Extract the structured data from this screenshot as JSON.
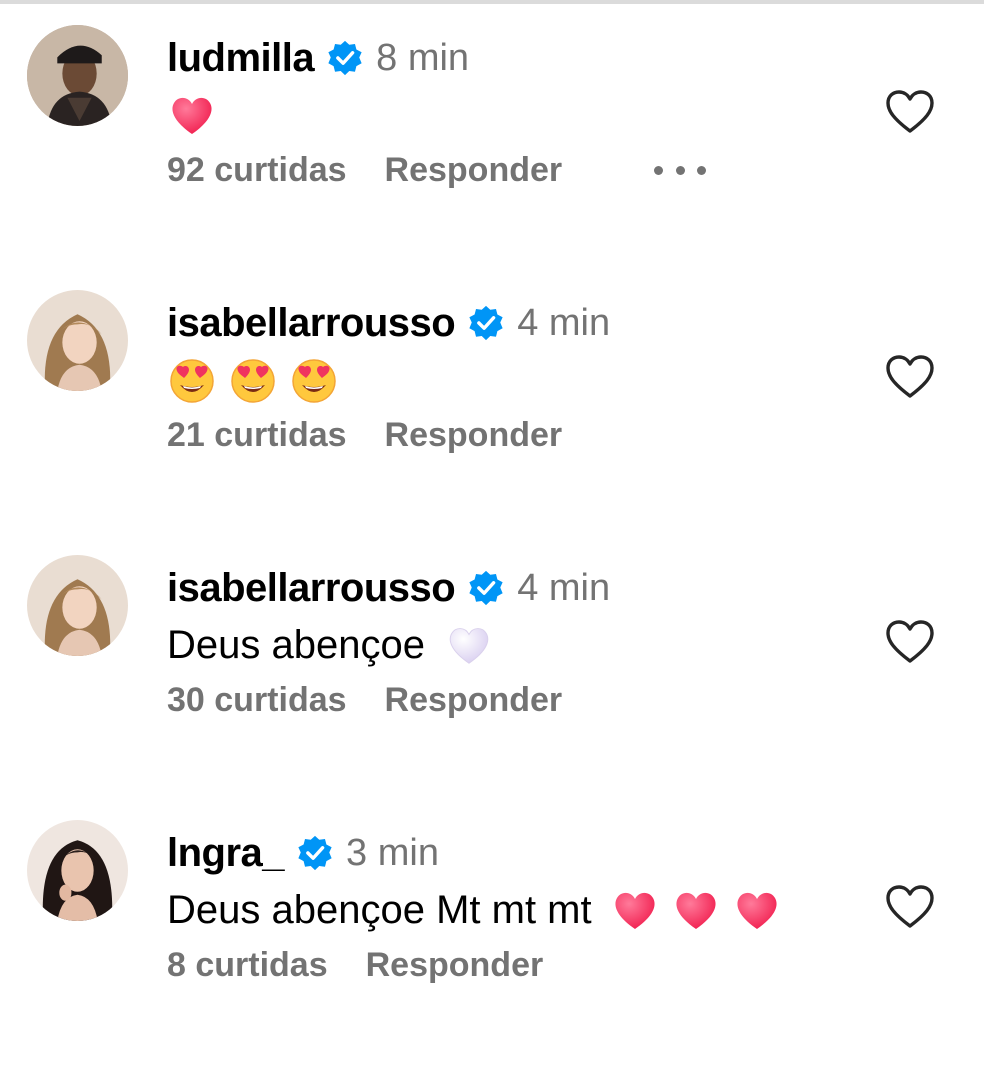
{
  "colors": {
    "text": "#000000",
    "muted": "#737373",
    "verified": "#0095f6",
    "heart_red": "#ff2e57",
    "heart_white": "#e6def7"
  },
  "comments": [
    {
      "username": "ludmilla",
      "verified": true,
      "time": "8 min",
      "text": "",
      "emojis": [
        "red-heart"
      ],
      "likes": "92 curtidas",
      "reply": "Responder",
      "has_more_menu": true
    },
    {
      "username": "isabellarrousso",
      "verified": true,
      "time": "4 min",
      "text": "",
      "emojis": [
        "smiling-face-with-heart-eyes",
        "smiling-face-with-heart-eyes",
        "smiling-face-with-heart-eyes"
      ],
      "likes": "21 curtidas",
      "reply": "Responder",
      "has_more_menu": false
    },
    {
      "username": "isabellarrousso",
      "verified": true,
      "time": "4 min",
      "text": "Deus abençoe",
      "emojis": [
        "white-heart"
      ],
      "likes": "30 curtidas",
      "reply": "Responder",
      "has_more_menu": false
    },
    {
      "username": "lngra_",
      "verified": true,
      "time": "3 min",
      "text": "Deus abençoe Mt mt mt",
      "emojis": [
        "red-heart",
        "red-heart",
        "red-heart"
      ],
      "likes": "8 curtidas",
      "reply": "Responder",
      "has_more_menu": false
    }
  ]
}
